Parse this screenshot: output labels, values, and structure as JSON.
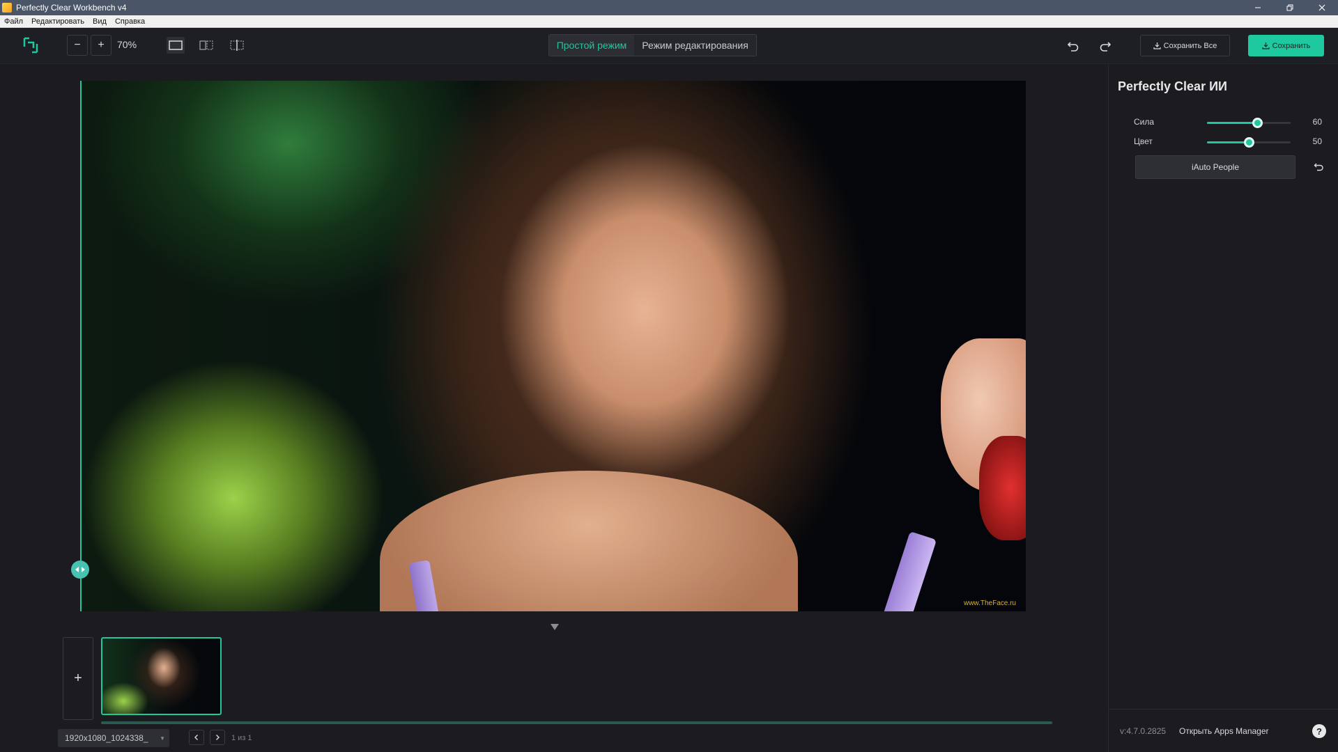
{
  "window": {
    "title": "Perfectly Clear Workbench v4"
  },
  "menu": {
    "items": [
      "Файл",
      "Редактировать",
      "Вид",
      "Справка"
    ]
  },
  "toolbar": {
    "zoom_out": "−",
    "zoom_in": "+",
    "zoom_level": "70%",
    "modes": {
      "simple": "Простой режим",
      "edit": "Режим редактирования"
    },
    "save_all": "Сохранить Все",
    "save": "Сохранить"
  },
  "canvas": {
    "watermark": "www.TheFace.ru"
  },
  "filmstrip": {
    "add_label": "+",
    "file_name": "1920x1080_1024338_",
    "page_count": "1 из 1"
  },
  "panel": {
    "title": "Perfectly Clear ИИ",
    "sliders": [
      {
        "label": "Сила",
        "value": 60
      },
      {
        "label": "Цвет",
        "value": 50
      }
    ],
    "preset": "iAuto People",
    "version": "v:4.7.0.2825",
    "apps_manager": "Открыть Apps Manager",
    "help": "?"
  },
  "colors": {
    "accent": "#1ec9a0",
    "titlebar": "#4a5568",
    "background": "#1c1c20"
  }
}
